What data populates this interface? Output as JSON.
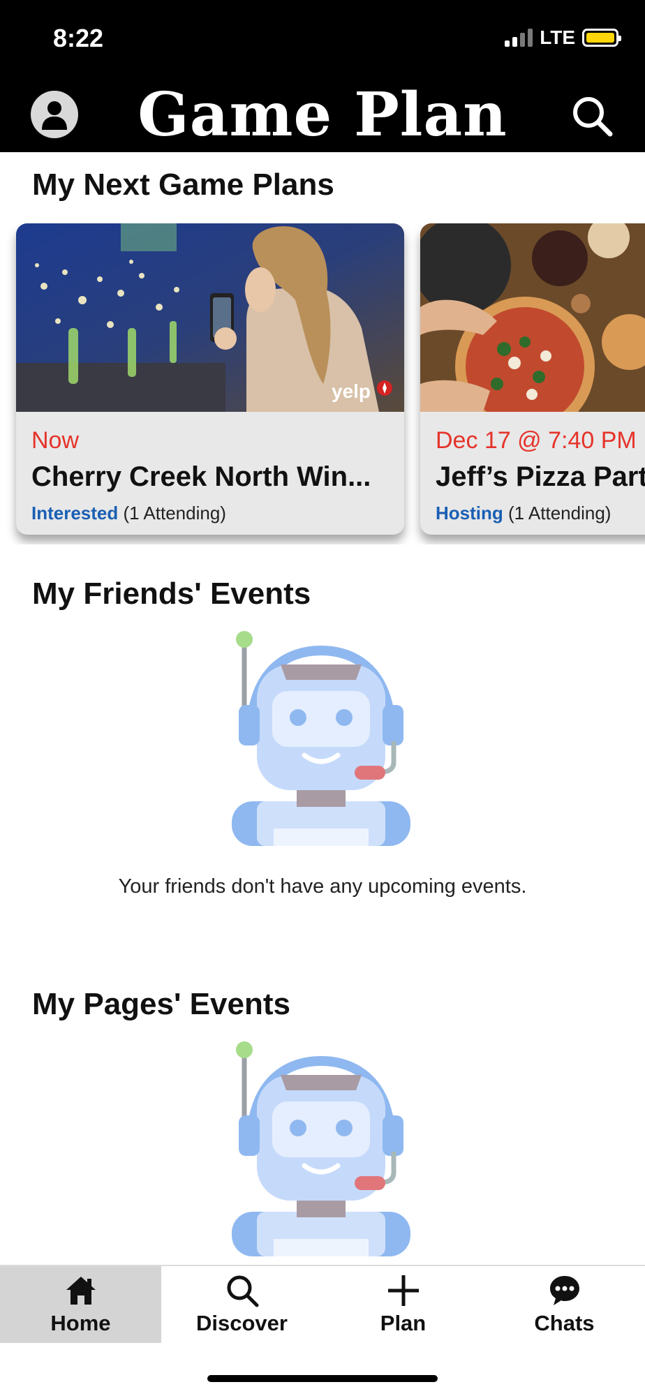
{
  "status_bar": {
    "time": "8:22",
    "network": "LTE",
    "battery_color": "#ffd60a"
  },
  "header": {
    "title": "Game Plan",
    "profile_icon": "person-icon",
    "search_icon": "search-icon"
  },
  "next_game_plans": {
    "title": "My Next Game Plans",
    "cards": [
      {
        "date": "Now",
        "title": "Cherry Creek North Win...",
        "rsvp": "Interested",
        "attending": "(1 Attending)",
        "badge": "yelp"
      },
      {
        "date": "Dec 17 @ 7:40 PM",
        "title": "Jeff’s Pizza Party",
        "rsvp": "Hosting",
        "attending": "(1 Attending)"
      }
    ]
  },
  "friends_events": {
    "title": "My Friends' Events",
    "empty_text": "Your friends don't have any upcoming events.",
    "illustration": "robot-icon"
  },
  "pages_events": {
    "title": "My Pages' Events",
    "illustration": "robot-icon"
  },
  "tab_bar": {
    "tabs": [
      {
        "label": "Home",
        "icon": "home-icon",
        "active": true
      },
      {
        "label": "Discover",
        "icon": "search-icon",
        "active": false
      },
      {
        "label": "Plan",
        "icon": "plus-icon",
        "active": false
      },
      {
        "label": "Chats",
        "icon": "chat-bubble-icon",
        "active": false
      }
    ]
  },
  "colors": {
    "date_red": "#e5332a",
    "rsvp_blue": "#1a5fb4",
    "header_bg": "#000000"
  }
}
